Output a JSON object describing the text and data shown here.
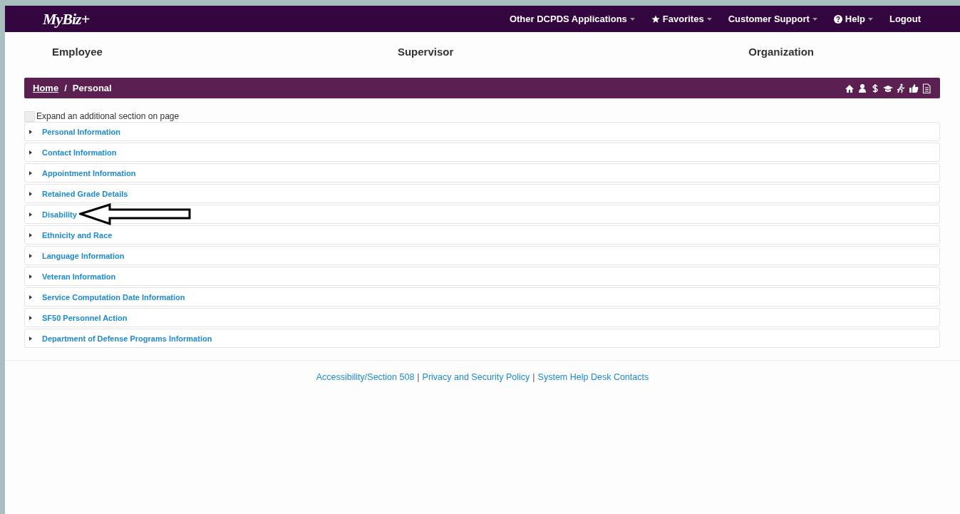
{
  "navbar": {
    "logo": "MyBiz+",
    "items": [
      {
        "label": "Other DCPDS Applications",
        "kind": "plain",
        "dropdown": true
      },
      {
        "label": "Favorites",
        "kind": "starred",
        "dropdown": true
      },
      {
        "label": "Customer Support",
        "kind": "plain",
        "dropdown": true
      },
      {
        "label": "Help",
        "kind": "help",
        "dropdown": true
      },
      {
        "label": "Logout",
        "kind": "plain",
        "dropdown": false
      }
    ]
  },
  "role_tabs": [
    "Employee",
    "Supervisor",
    "Organization"
  ],
  "breadcrumb": {
    "home": "Home",
    "separator": "/",
    "current": "Personal"
  },
  "expand_option": {
    "label": "Expand an additional section on page",
    "checked": false
  },
  "sections": [
    {
      "label": "Personal Information",
      "expanded": false,
      "annotated": false
    },
    {
      "label": "Contact Information",
      "expanded": false,
      "annotated": false
    },
    {
      "label": "Appointment Information",
      "expanded": false,
      "annotated": false
    },
    {
      "label": "Retained Grade Details",
      "expanded": false,
      "annotated": false
    },
    {
      "label": "Disability",
      "expanded": false,
      "annotated": true
    },
    {
      "label": "Ethnicity and Race",
      "expanded": false,
      "annotated": false
    },
    {
      "label": "Language Information",
      "expanded": false,
      "annotated": false
    },
    {
      "label": "Veteran Information",
      "expanded": false,
      "annotated": false
    },
    {
      "label": "Service Computation Date Information",
      "expanded": false,
      "annotated": false
    },
    {
      "label": "SF50 Personnel Action",
      "expanded": false,
      "annotated": false
    },
    {
      "label": "Department of Defense Programs Information",
      "expanded": false,
      "annotated": false
    }
  ],
  "footer": {
    "links": [
      "Accessibility/Section 508",
      "Privacy and Security Policy",
      "System Help Desk Contacts"
    ],
    "separator": "|"
  }
}
